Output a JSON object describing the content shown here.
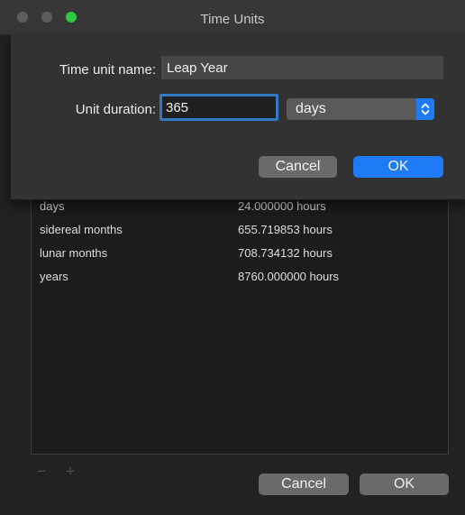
{
  "window": {
    "title": "Time Units",
    "accent_color": "#1f7bf5"
  },
  "units": {
    "rows": [
      {
        "name": "days",
        "duration": "24.000000 hours"
      },
      {
        "name": "sidereal months",
        "duration": "655.719853 hours"
      },
      {
        "name": "lunar months",
        "duration": "708.734132 hours"
      },
      {
        "name": "years",
        "duration": "8760.000000 hours"
      }
    ],
    "remove_symbol": "−",
    "add_symbol": "+"
  },
  "main_buttons": {
    "cancel": "Cancel",
    "ok": "OK"
  },
  "sheet": {
    "name_label": "Time unit name:",
    "name_value": "Leap Year",
    "duration_label": "Unit duration:",
    "duration_value": "365",
    "unit_selected": "days",
    "cancel": "Cancel",
    "ok": "OK"
  }
}
